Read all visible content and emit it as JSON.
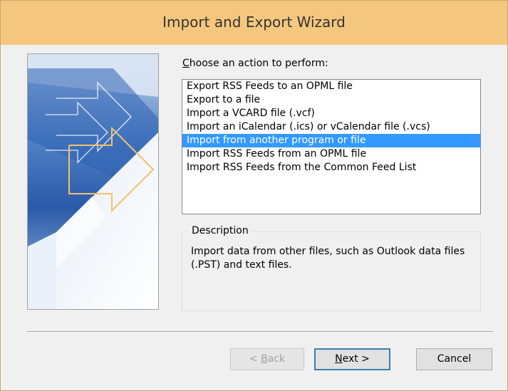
{
  "window": {
    "title": "Import and Export Wizard"
  },
  "prompt": {
    "label_accel": "C",
    "label_rest": "hoose an action to perform:"
  },
  "actions": [
    {
      "label": "Export RSS Feeds to an OPML file",
      "selected": false
    },
    {
      "label": "Export to a file",
      "selected": false
    },
    {
      "label": "Import a VCARD file (.vcf)",
      "selected": false
    },
    {
      "label": "Import an iCalendar (.ics) or vCalendar file (.vcs)",
      "selected": false
    },
    {
      "label": "Import from another program or file",
      "selected": true
    },
    {
      "label": "Import RSS Feeds from an OPML file",
      "selected": false
    },
    {
      "label": "Import RSS Feeds from the Common Feed List",
      "selected": false
    }
  ],
  "description": {
    "legend": "Description",
    "text": "Import data from other files, such as Outlook data files (.PST) and text files."
  },
  "buttons": {
    "back_prefix": "< ",
    "back_accel": "B",
    "back_rest": "ack",
    "next_accel": "N",
    "next_rest": "ext >",
    "cancel": "Cancel"
  },
  "colors": {
    "titlebar": "#f5c77e",
    "selection": "#3399ff",
    "arrow": "#f5c06a"
  }
}
